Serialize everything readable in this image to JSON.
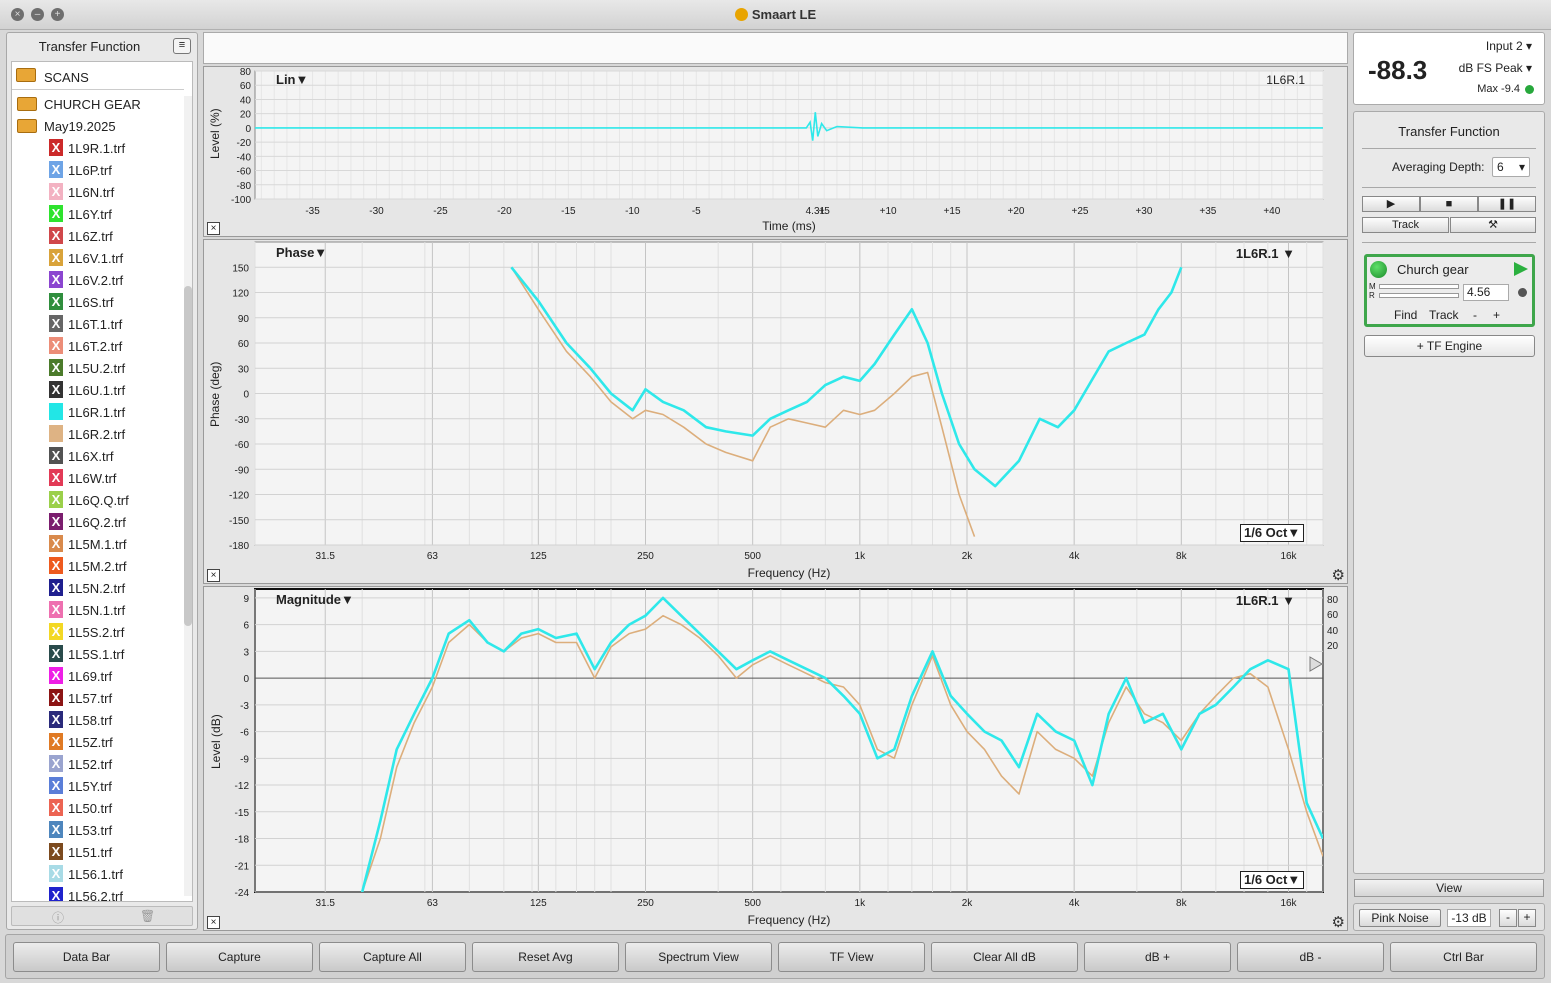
{
  "window": {
    "title": "Smaart LE"
  },
  "sidebar": {
    "title": "Transfer Function",
    "root_folder": "SCANS",
    "folders": [
      "CHURCH GEAR",
      "May19.2025"
    ],
    "files": [
      {
        "name": "1L9R.1.trf",
        "color": "#cc2a2a"
      },
      {
        "name": "1L6P.trf",
        "color": "#6ea4e6"
      },
      {
        "name": "1L6N.trf",
        "color": "#f3b2c2"
      },
      {
        "name": "1L6Y.trf",
        "color": "#2ee32e"
      },
      {
        "name": "1L6Z.trf",
        "color": "#d0474a"
      },
      {
        "name": "1L6V.1.trf",
        "color": "#d9a33a"
      },
      {
        "name": "1L6V.2.trf",
        "color": "#8b45d0"
      },
      {
        "name": "1L6S.trf",
        "color": "#2f8e3d"
      },
      {
        "name": "1L6T.1.trf",
        "color": "#666666"
      },
      {
        "name": "1L6T.2.trf",
        "color": "#ec8d78"
      },
      {
        "name": "1L5U.2.trf",
        "color": "#4b7b2b"
      },
      {
        "name": "1L6U.1.trf",
        "color": "#333333"
      },
      {
        "name": "1L6R.1.trf",
        "color": "#22e6e6"
      },
      {
        "name": "1L6R.2.trf",
        "color": "#deb384"
      },
      {
        "name": "1L6X.trf",
        "color": "#525252"
      },
      {
        "name": "1L6W.trf",
        "color": "#e23a56"
      },
      {
        "name": "1L6Q.Q.trf",
        "color": "#9bd04a"
      },
      {
        "name": "1L6Q.2.trf",
        "color": "#7b1d6e"
      },
      {
        "name": "1L5M.1.trf",
        "color": "#d98a4c"
      },
      {
        "name": "1L5M.2.trf",
        "color": "#ee5a1e"
      },
      {
        "name": "1L5N.2.trf",
        "color": "#1f1f8f"
      },
      {
        "name": "1L5N.1.trf",
        "color": "#ee70b0"
      },
      {
        "name": "1L5S.2.trf",
        "color": "#f3d824"
      },
      {
        "name": "1L5S.1.trf",
        "color": "#2a4b4b"
      },
      {
        "name": "1L69.trf",
        "color": "#ee1ee6"
      },
      {
        "name": "1L57.trf",
        "color": "#8c1414"
      },
      {
        "name": "1L58.trf",
        "color": "#2a2a7b"
      },
      {
        "name": "1L5Z.trf",
        "color": "#e07a24"
      },
      {
        "name": "1L52.trf",
        "color": "#9aa4cf"
      },
      {
        "name": "1L5Y.trf",
        "color": "#5a7ed8"
      },
      {
        "name": "1L50.trf",
        "color": "#ec6452"
      },
      {
        "name": "1L53.trf",
        "color": "#4e86bd"
      },
      {
        "name": "1L51.trf",
        "color": "#7c4a1e"
      },
      {
        "name": "1L56.1.trf",
        "color": "#a8dbe6"
      },
      {
        "name": "1L56.2.trf",
        "color": "#1f22cc"
      }
    ]
  },
  "impulse": {
    "overlay": "Lin▼",
    "trace": "1L6R.1",
    "ylabel": "Level (%)",
    "xlabel": "Time (ms)",
    "y_ticks": [
      "80",
      "60",
      "40",
      "20",
      "0",
      "-20",
      "-40",
      "-60",
      "-80",
      "-100"
    ],
    "x_ticks": [
      "-35",
      "-30",
      "-25",
      "-20",
      "-15",
      "-10",
      "-5",
      "4.31",
      "+5",
      "+10",
      "+15",
      "+20",
      "+25",
      "+30",
      "+35",
      "+40"
    ]
  },
  "phase": {
    "overlay": "Phase▼",
    "trace": "1L6R.1 ▼",
    "ylabel": "Phase (deg)",
    "xlabel": "Frequency (Hz)",
    "smoothing": "1/6 Oct▼",
    "y_ticks": [
      "150",
      "120",
      "90",
      "60",
      "30",
      "0",
      "-30",
      "-60",
      "-90",
      "-120",
      "-150",
      "-180"
    ],
    "x_ticks": [
      "31.5",
      "63",
      "125",
      "250",
      "500",
      "1k",
      "2k",
      "4k",
      "8k",
      "16k"
    ]
  },
  "magnitude": {
    "overlay": "Magnitude▼",
    "trace": "1L6R.1 ▼",
    "ylabel": "Level (dB)",
    "xlabel": "Frequency (Hz)",
    "smoothing": "1/6 Oct▼",
    "y_ticks": [
      "9",
      "6",
      "3",
      "0",
      "-3",
      "-6",
      "-9",
      "-12",
      "-15",
      "-18",
      "-21",
      "-24"
    ],
    "coh_ticks": [
      "80",
      "60",
      "40",
      "20"
    ],
    "x_ticks": [
      "31.5",
      "63",
      "125",
      "250",
      "500",
      "1k",
      "2k",
      "4k",
      "8k",
      "16k"
    ]
  },
  "meter": {
    "value": "-88.3",
    "input": "Input 2",
    "mode": "dB FS Peak",
    "max": "Max -9.4"
  },
  "control": {
    "title": "Transfer Function",
    "averaging_label": "Averaging Depth:",
    "averaging_value": "6",
    "track_label": "Track",
    "engine_name": "Church gear",
    "engine_value": "4.56",
    "meter_m": "M",
    "meter_r": "R",
    "find_label": "Find",
    "track_small": "Track",
    "minus": "-",
    "plus": "+",
    "new_engine": "+ TF Engine",
    "view": "View",
    "pink_noise": "Pink Noise",
    "pink_level": "-13 dB"
  },
  "bottom_buttons": [
    "Data Bar",
    "Capture",
    "Capture All",
    "Reset Avg",
    "Spectrum View",
    "TF View",
    "Clear All dB",
    "dB +",
    "dB -",
    "Ctrl Bar"
  ],
  "chart_data": [
    {
      "type": "line",
      "title": "Lin",
      "xlabel": "Time (ms)",
      "ylabel": "Level (%)",
      "xlim": [
        -39.5,
        44
      ],
      "ylim": [
        -100,
        80
      ],
      "series": [
        {
          "name": "1L6R.1",
          "x": [
            -39.5,
            3.6,
            3.9,
            4.1,
            4.31,
            4.5,
            4.8,
            5.2,
            6.0,
            8.0,
            44
          ],
          "y": [
            0,
            0,
            8,
            -18,
            22,
            -12,
            6,
            -4,
            2,
            0,
            0
          ]
        }
      ]
    },
    {
      "type": "line",
      "title": "Phase",
      "xlabel": "Frequency (Hz)",
      "ylabel": "Phase (deg)",
      "xscale": "log",
      "xlim": [
        20,
        20000
      ],
      "ylim": [
        -180,
        180
      ],
      "series": [
        {
          "name": "1L6R.1",
          "x": [
            105,
            125,
            150,
            175,
            200,
            230,
            250,
            280,
            320,
            370,
            420,
            500,
            560,
            630,
            710,
            800,
            900,
            1000,
            1100,
            1250,
            1400,
            1550,
            1700,
            1900,
            2100,
            2400,
            2800,
            3200,
            3600,
            4000,
            4400,
            5000,
            5600,
            6300,
            6900,
            7500,
            8000
          ],
          "y": [
            150,
            110,
            60,
            30,
            0,
            -20,
            5,
            -10,
            -20,
            -40,
            -45,
            -50,
            -30,
            -20,
            -10,
            10,
            20,
            15,
            35,
            70,
            100,
            60,
            0,
            -60,
            -90,
            -110,
            -80,
            -30,
            -40,
            -20,
            10,
            50,
            60,
            70,
            100,
            120,
            150
          ]
        },
        {
          "name": "1L6R.2",
          "x": [
            105,
            125,
            150,
            175,
            200,
            230,
            250,
            280,
            320,
            370,
            420,
            500,
            560,
            630,
            710,
            800,
            900,
            1000,
            1100,
            1250,
            1400,
            1550,
            1700,
            1900,
            2100
          ],
          "y": [
            150,
            100,
            50,
            20,
            -10,
            -30,
            -20,
            -25,
            -40,
            -60,
            -70,
            -80,
            -40,
            -30,
            -35,
            -40,
            -20,
            -25,
            -20,
            0,
            20,
            25,
            -40,
            -120,
            -170
          ]
        }
      ]
    },
    {
      "type": "line",
      "title": "Magnitude",
      "xlabel": "Frequency (Hz)",
      "ylabel": "Level (dB)",
      "xscale": "log",
      "xlim": [
        20,
        20000
      ],
      "ylim": [
        -24,
        10
      ],
      "series": [
        {
          "name": "1L6R.1",
          "x": [
            40,
            45,
            50,
            56,
            63,
            70,
            80,
            90,
            100,
            112,
            125,
            140,
            160,
            180,
            200,
            225,
            250,
            280,
            315,
            355,
            400,
            450,
            500,
            560,
            630,
            710,
            800,
            900,
            1000,
            1120,
            1250,
            1400,
            1600,
            1800,
            2000,
            2240,
            2500,
            2800,
            3150,
            3550,
            4000,
            4500,
            5000,
            5600,
            6300,
            7100,
            8000,
            9000,
            10000,
            11200,
            12500,
            14000,
            16000,
            18000,
            20000
          ],
          "y": [
            -24,
            -16,
            -8,
            -4,
            0,
            5,
            6.5,
            4,
            3,
            5,
            5.5,
            4.5,
            5,
            1,
            4,
            6,
            7,
            9,
            7,
            5,
            3,
            1,
            2,
            3,
            2,
            1,
            0,
            -2,
            -4,
            -9,
            -8,
            -2,
            3,
            -2,
            -4,
            -6,
            -7,
            -10,
            -4,
            -6,
            -7,
            -12,
            -4,
            0,
            -5,
            -4,
            -8,
            -4,
            -3,
            -1,
            1,
            2,
            1,
            -14,
            -18
          ]
        },
        {
          "name": "1L6R.2",
          "x": [
            40,
            45,
            50,
            56,
            63,
            70,
            80,
            90,
            100,
            112,
            125,
            140,
            160,
            180,
            200,
            225,
            250,
            280,
            315,
            355,
            400,
            450,
            500,
            560,
            630,
            710,
            800,
            900,
            1000,
            1120,
            1250,
            1400,
            1600,
            1800,
            2000,
            2240,
            2500,
            2800,
            3150,
            3550,
            4000,
            4500,
            5000,
            5600,
            6300,
            7100,
            8000,
            9000,
            10000,
            11200,
            12500,
            14000,
            16000,
            18000,
            20000
          ],
          "y": [
            -24,
            -18,
            -10,
            -5,
            -1,
            4,
            6,
            4,
            3,
            4.5,
            5,
            4,
            4,
            0,
            3.5,
            5,
            5.5,
            7,
            6,
            4.5,
            2.5,
            0,
            1.5,
            2.5,
            1.5,
            0.5,
            -0.5,
            -1,
            -3,
            -8,
            -9,
            -3,
            2.5,
            -3,
            -6,
            -8,
            -11,
            -13,
            -6,
            -8,
            -9,
            -11,
            -5,
            -1,
            -4,
            -5,
            -7,
            -4,
            -2,
            0,
            0.5,
            -1,
            -8,
            -15,
            -20
          ]
        }
      ]
    }
  ]
}
